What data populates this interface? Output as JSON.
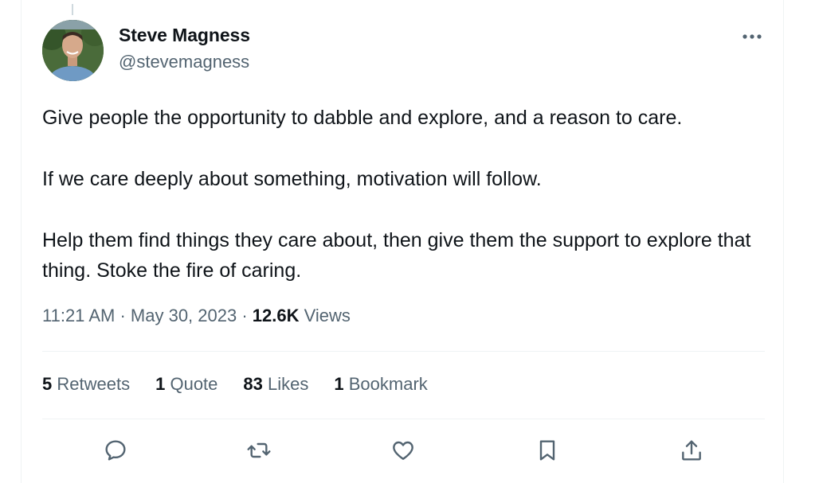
{
  "tweet": {
    "author": {
      "name": "Steve Magness",
      "handle": "@stevemagness"
    },
    "paragraphs": [
      "Give people the opportunity to dabble and explore, and a reason to care.",
      "If we care deeply about something, motivation will follow.",
      "Help them find things they care about, then give them the support to explore that thing. Stoke the fire of caring."
    ],
    "time": "11:21 AM",
    "separator": "·",
    "date": "May 30, 2023",
    "views_count": "12.6K",
    "views_label": "Views",
    "stats": {
      "retweets": {
        "count": "5",
        "label": "Retweets"
      },
      "quotes": {
        "count": "1",
        "label": "Quote"
      },
      "likes": {
        "count": "83",
        "label": "Likes"
      },
      "bookmarks": {
        "count": "1",
        "label": "Bookmark"
      }
    }
  },
  "icons": {
    "more": "more-horizontal-icon",
    "reply": "reply-icon",
    "retweet": "retweet-icon",
    "like": "heart-icon",
    "bookmark": "bookmark-icon",
    "share": "share-icon"
  },
  "colors": {
    "text_primary": "#0f1419",
    "text_secondary": "#536471",
    "divider": "#eff3f4"
  }
}
